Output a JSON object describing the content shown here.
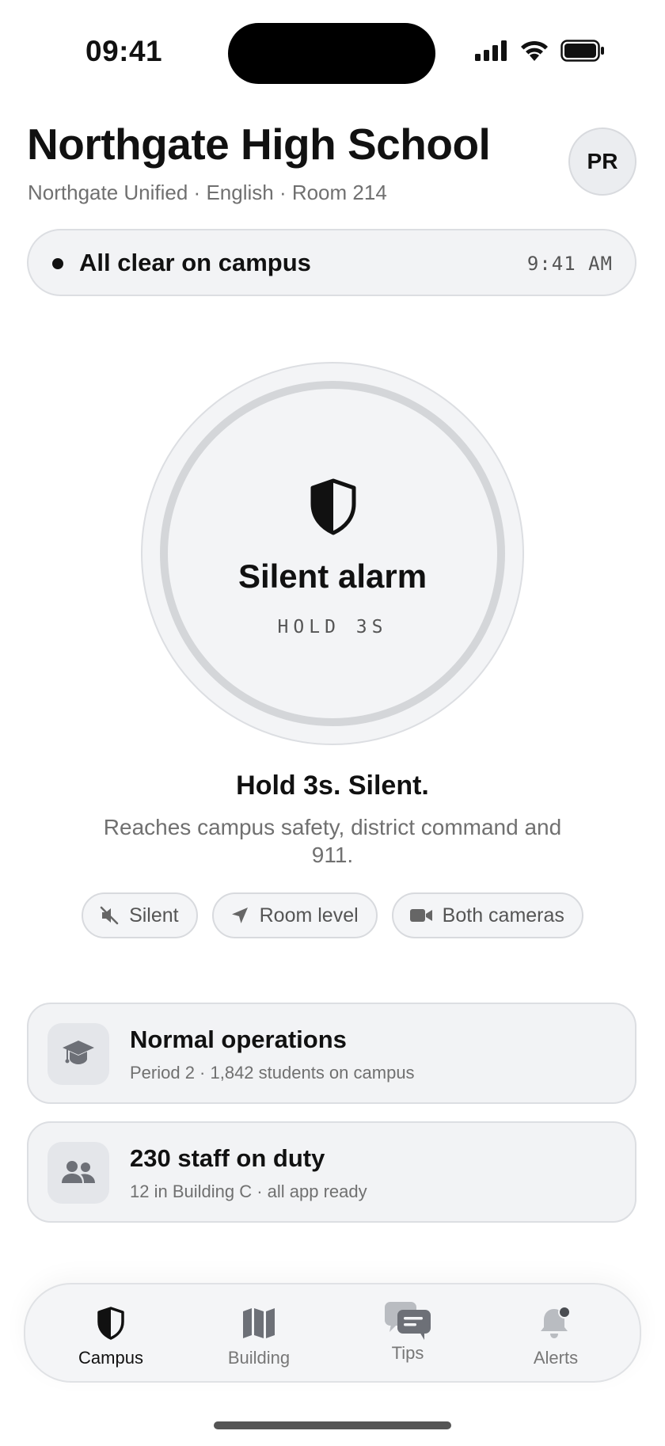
{
  "status_bar": {
    "time": "09:41",
    "icons": [
      "signal-icon",
      "wifi-icon",
      "battery-icon"
    ]
  },
  "header": {
    "title": "Northgate High School",
    "subtitle": "Northgate Unified · English · Room 214",
    "avatar_initials": "PR"
  },
  "campus_status": {
    "text": "All clear on campus",
    "time": "9:41 AM"
  },
  "alarm": {
    "icon": "shield-icon",
    "label": "Silent alarm",
    "hold_hint": "HOLD 3S",
    "title": "Hold 3s. Silent.",
    "description": "Reaches campus safety, district command and 911."
  },
  "chips": [
    {
      "icon": "muted-speaker-icon",
      "label": "Silent"
    },
    {
      "icon": "location-arrow-icon",
      "label": "Room level"
    },
    {
      "icon": "video-camera-icon",
      "label": "Both cameras"
    }
  ],
  "cards": [
    {
      "icon": "graduation-cap-icon",
      "title": "Normal operations",
      "subtitle": "Period 2 · 1,842 students on campus"
    },
    {
      "icon": "people-icon",
      "title": "230 staff on duty",
      "subtitle": "12 in Building C · all app ready"
    }
  ],
  "tabs": [
    {
      "icon": "shield-icon",
      "label": "Campus",
      "active": true
    },
    {
      "icon": "map-icon",
      "label": "Building",
      "active": false
    },
    {
      "icon": "chat-bubbles-icon",
      "label": "Tips",
      "active": false
    },
    {
      "icon": "bell-badge-icon",
      "label": "Alerts",
      "active": false
    }
  ],
  "colors": {
    "text": "#111111",
    "muted": "#707070",
    "surface": "#f2f3f5",
    "border": "#dcdee2"
  }
}
